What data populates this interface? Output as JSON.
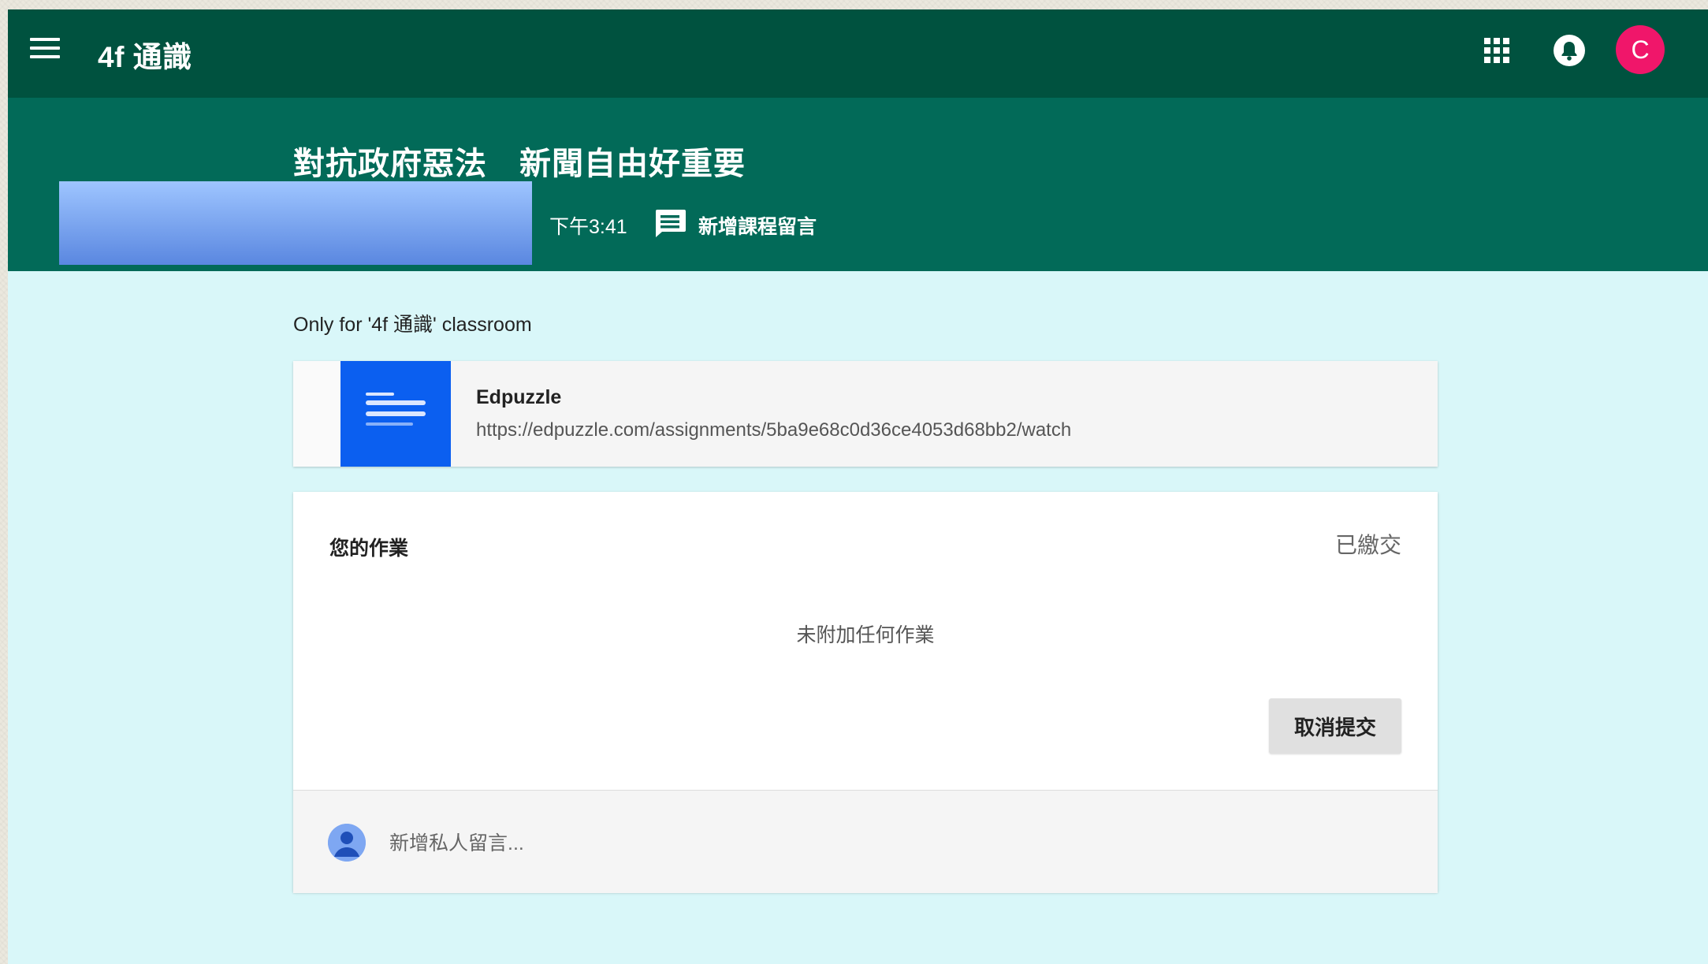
{
  "topbar": {
    "class_name": "4f 通識",
    "avatar_letter": "C",
    "avatar_color": "#f0166a",
    "menu_icon": "hamburger-menu-icon",
    "apps_icon": "apps-grid-icon",
    "notifications_icon": "bell-icon"
  },
  "banner": {
    "title": "對抗政府惡法　新聞自由好重要",
    "time": "下午3:41",
    "add_comment_label": "新增課程留言",
    "comment_icon": "comment-icon"
  },
  "main": {
    "only_for": "Only for '4f 通識' classroom",
    "attachment": {
      "title": "Edpuzzle",
      "url": "https://edpuzzle.com/assignments/5ba9e68c0d36ce4053d68bb2/watch"
    },
    "work": {
      "label": "您的作業",
      "status": "已繳交",
      "empty_text": "未附加任何作業",
      "unsubmit_label": "取消提交",
      "private_comment_placeholder": "新增私人留言..."
    }
  },
  "colors": {
    "topbar": "#00523f",
    "banner": "#026a58",
    "background": "#d9f7f9"
  }
}
